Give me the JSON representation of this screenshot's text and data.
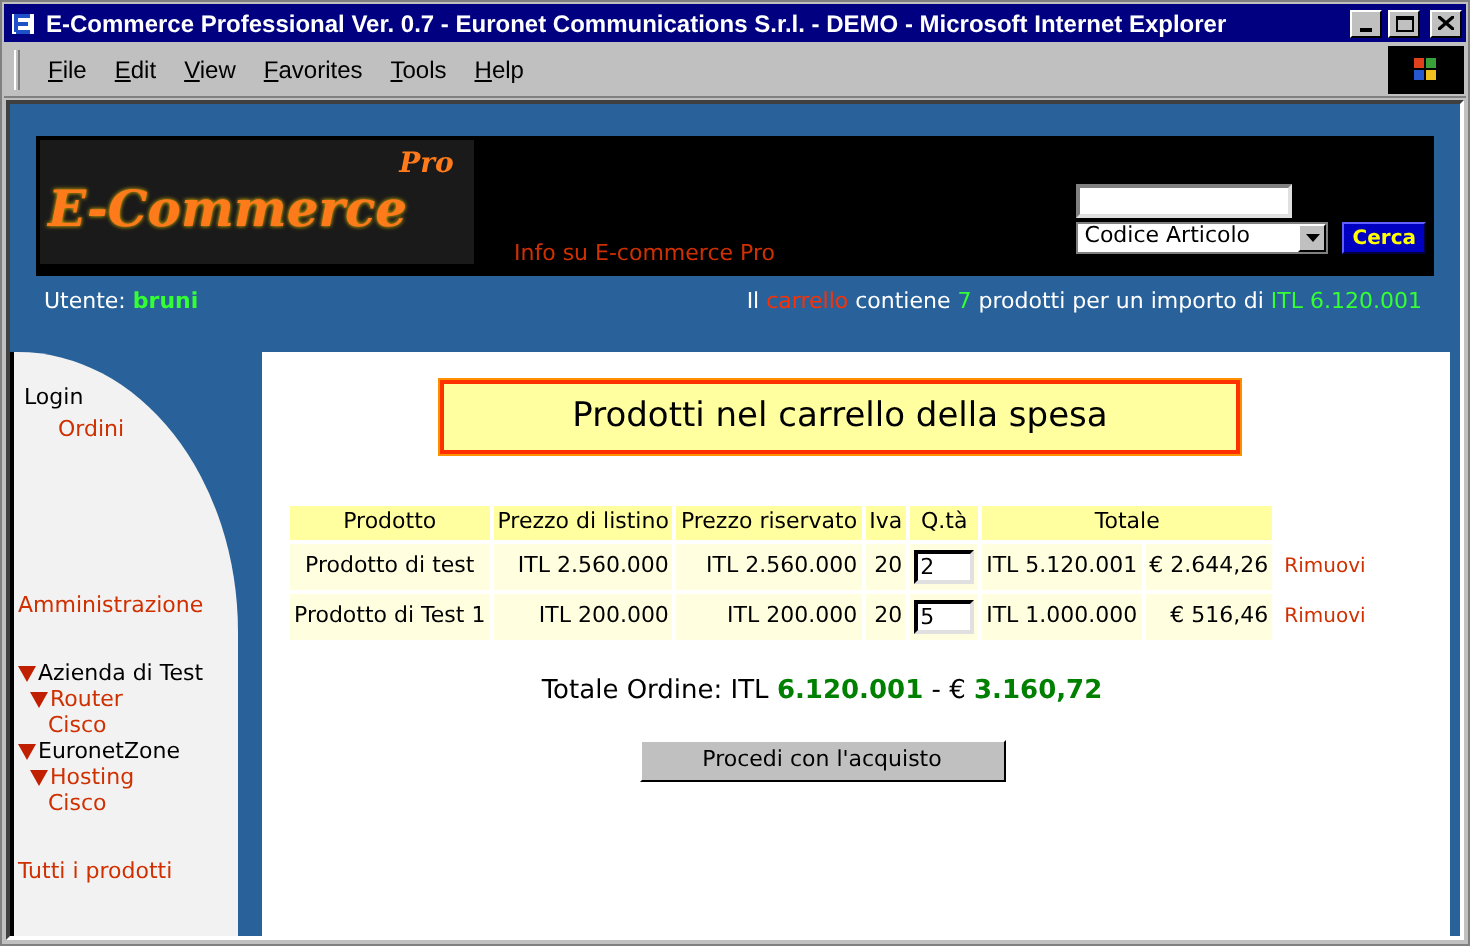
{
  "window": {
    "title": "E-Commerce Professional Ver. 0.7 - Euronet Communications S.r.l. - DEMO - Microsoft Internet Explorer"
  },
  "menu": [
    "File",
    "Edit",
    "View",
    "Favorites",
    "Tools",
    "Help"
  ],
  "header": {
    "logo_text": "E-Commerce",
    "logo_sup": "Pro",
    "info_link": "Info su E-commerce Pro",
    "search_select": "Codice Articolo",
    "search_button": "Cerca"
  },
  "user_bar": {
    "label": "Utente:",
    "user": "bruni",
    "cart_summary": [
      {
        "kind": "plain",
        "text": "Il "
      },
      {
        "kind": "link",
        "text": "carrello"
      },
      {
        "kind": "plain",
        "text": " contiene "
      },
      {
        "kind": "value",
        "text": "7"
      },
      {
        "kind": "plain",
        "text": " prodotti per un importo di "
      },
      {
        "kind": "value",
        "text": "ITL 6.120.001"
      }
    ]
  },
  "sidebar": {
    "items": [
      {
        "kind": "label",
        "text": "Login"
      },
      {
        "kind": "sublink",
        "text": "Ordini"
      },
      {
        "kind": "link",
        "text": "Amministrazione"
      },
      {
        "kind": "tree",
        "text": "Azienda di Test",
        "expanded": true,
        "children": [
          {
            "text": "Router",
            "expanded": true,
            "children": [
              {
                "text": "Cisco"
              }
            ]
          }
        ]
      },
      {
        "kind": "tree",
        "text": "EuronetZone",
        "expanded": true,
        "children": [
          {
            "text": "Hosting",
            "expanded": true,
            "children": [
              {
                "text": "Cisco"
              }
            ]
          }
        ]
      },
      {
        "kind": "link",
        "text": "Tutti i prodotti"
      }
    ]
  },
  "main": {
    "title": "Prodotti nel carrello della spesa",
    "table": {
      "columns": [
        "Prodotto",
        "Prezzo di listino",
        "Prezzo riservato",
        "Iva",
        "Q.tà",
        "Totale"
      ],
      "rows": [
        {
          "product": "Prodotto di test",
          "list_price": "ITL 2.560.000",
          "reserved_price": "ITL 2.560.000",
          "iva": "20",
          "qty": "2",
          "total_itl": "ITL 5.120.001",
          "total_eur": "€ 2.644,26",
          "remove": "Rimuovi"
        },
        {
          "product": "Prodotto di Test 1",
          "list_price": "ITL 200.000",
          "reserved_price": "ITL 200.000",
          "iva": "20",
          "qty": "5",
          "total_itl": "ITL 1.000.000",
          "total_eur": "€ 516,46",
          "remove": "Rimuovi"
        }
      ]
    },
    "order_total": "Totale Ordine: ITL **6.120.001** - € **3.160,72**",
    "proceed_button": "Procedi con l'acquisto"
  }
}
